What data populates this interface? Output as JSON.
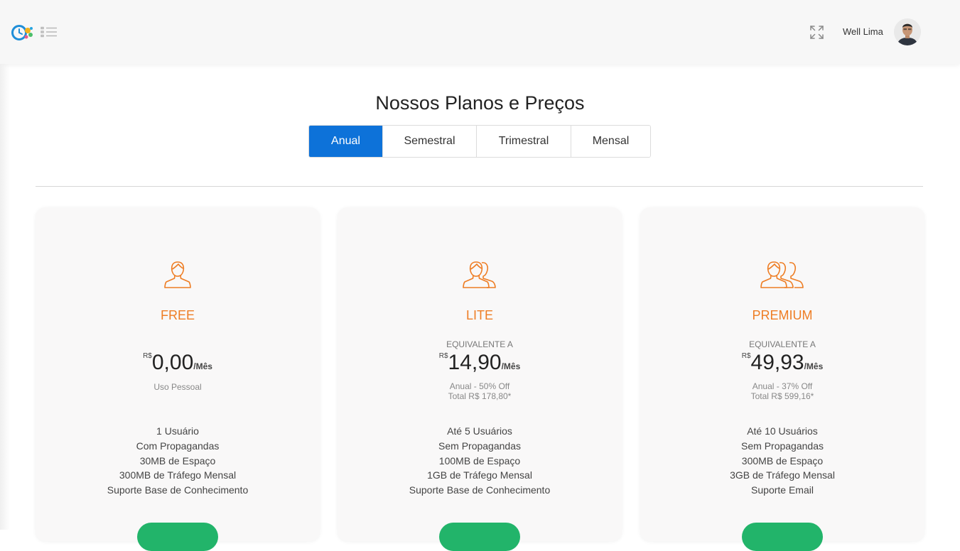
{
  "header": {
    "user_name": "Well Lima",
    "icons": {
      "logo": "app-logo-clock-gear",
      "menu": "list-menu-icon",
      "fullscreen": "expand-icon",
      "avatar": "user-avatar"
    }
  },
  "page": {
    "title": "Nossos Planos e Preços"
  },
  "period_tabs": [
    {
      "label": "Anual",
      "active": true
    },
    {
      "label": "Semestral",
      "active": false
    },
    {
      "label": "Trimestral",
      "active": false
    },
    {
      "label": "Mensal",
      "active": false
    }
  ],
  "plans": [
    {
      "name": "FREE",
      "icon": "single-user-icon",
      "equivalent_label": "",
      "currency": "R$",
      "price": "0,00",
      "per": "/Mês",
      "note_line1": "Uso Pessoal",
      "note_line2": "",
      "features": [
        "1 Usuário",
        "Com Propagandas",
        "30MB de Espaço",
        "300MB de Tráfego Mensal",
        "Suporte Base de Conhecimento"
      ]
    },
    {
      "name": "LITE",
      "icon": "two-users-icon",
      "equivalent_label": "EQUIVALENTE A",
      "currency": "R$",
      "price": "14,90",
      "per": "/Mês",
      "note_line1": "Anual - 50% Off",
      "note_line2": "Total R$ 178,80*",
      "features": [
        "Até 5 Usuários",
        "Sem Propagandas",
        "100MB de Espaço",
        "1GB de Tráfego Mensal",
        "Suporte Base de Conhecimento"
      ]
    },
    {
      "name": "PREMIUM",
      "icon": "three-users-icon",
      "equivalent_label": "EQUIVALENTE A",
      "currency": "R$",
      "price": "49,93",
      "per": "/Mês",
      "note_line1": "Anual - 37% Off",
      "note_line2": "Total R$ 599,16*",
      "features": [
        "Até 10 Usuários",
        "Sem Propagandas",
        "300MB de Espaço",
        "3GB de Tráfego Mensal",
        "Suporte Email"
      ]
    }
  ],
  "colors": {
    "accent_orange": "#ee7d24",
    "active_tab_blue": "#0d72d9",
    "cta_green": "#22b46a",
    "card_background": "#f9f8f8"
  }
}
